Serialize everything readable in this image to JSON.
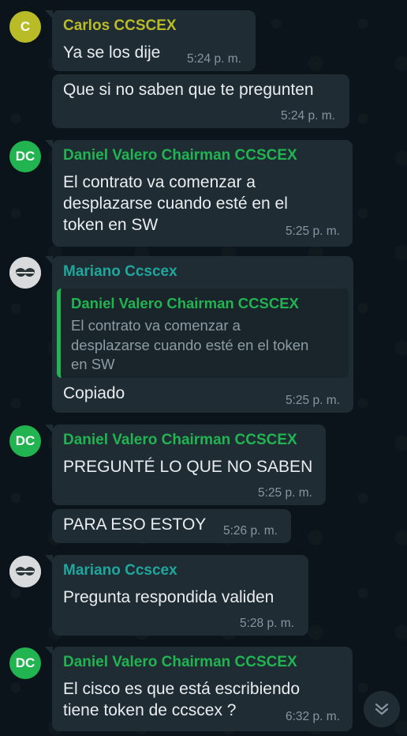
{
  "colors": {
    "background": "#0b141a",
    "bubble": "#1f2c34",
    "sender_carlos": "#b9bb27",
    "sender_daniel": "#21b451",
    "sender_mariano": "#1fa79d",
    "time": "#8696a0"
  },
  "messages": [
    {
      "avatar": "C",
      "sender": "Carlos CCSCEX",
      "text": [
        "Ya se los dije"
      ],
      "time": "5:24 p. m."
    },
    {
      "text": [
        "Que si no saben que te pregunten"
      ],
      "time": "5:24 p. m."
    },
    {
      "avatar": "DC",
      "sender": "Daniel Valero Chairman CCSCEX",
      "text": [
        "El contrato va comenzar a",
        "desplazarse cuando esté en el",
        "token en SW"
      ],
      "time": "5:25 p. m."
    },
    {
      "avatar_icon": "mask-avatar-icon",
      "sender": "Mariano Ccscex",
      "quote": {
        "sender": "Daniel Valero Chairman CCSCEX",
        "text": [
          "El contrato va comenzar a",
          "desplazarse cuando esté en el token",
          "en SW"
        ]
      },
      "text": [
        "Copiado"
      ],
      "time": "5:25 p. m."
    },
    {
      "avatar": "DC",
      "sender": "Daniel Valero Chairman CCSCEX",
      "text": [
        "PREGUNTÉ LO QUE NO SABEN"
      ],
      "time": "5:25 p. m."
    },
    {
      "text": [
        "PARA ESO ESTOY"
      ],
      "time": "5:26 p. m."
    },
    {
      "avatar_icon": "mask-avatar-icon",
      "sender": "Mariano Ccscex",
      "text": [
        "Pregunta respondida validen"
      ],
      "time": "5:28 p. m."
    },
    {
      "avatar": "DC",
      "sender": "Daniel Valero Chairman CCSCEX",
      "text": [
        "El cisco es que está escribiendo",
        "tiene token de ccscex ?"
      ],
      "time": "6:32 p. m."
    }
  ],
  "scroll_button_icon": "double-chevron-down-icon"
}
